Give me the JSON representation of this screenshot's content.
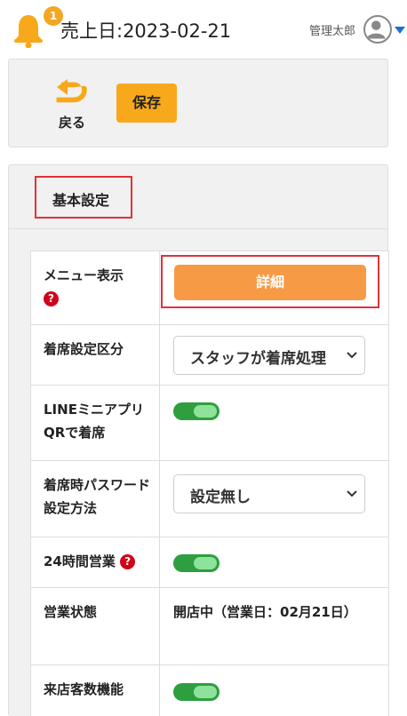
{
  "header": {
    "notification_count": "1",
    "title": "売上日:2023-02-21",
    "user_name": "管理太郎"
  },
  "toolbar": {
    "back_label": "戻る",
    "save_label": "保存"
  },
  "section": {
    "title": "基本設定"
  },
  "rows": [
    {
      "label": "メニュー表示",
      "help": true,
      "type": "button",
      "value": "詳細"
    },
    {
      "label": "着席設定区分",
      "help": false,
      "type": "select",
      "value": "スタッフが着席処理"
    },
    {
      "label": "LINEミニアプリQRで着席",
      "help": false,
      "type": "toggle",
      "on": true
    },
    {
      "label": "着席時パスワード設定方法",
      "help": false,
      "type": "select",
      "value": "設定無し"
    },
    {
      "label": "24時間営業",
      "help": true,
      "type": "toggle",
      "on": true
    },
    {
      "label": "営業状態",
      "help": false,
      "type": "text",
      "value": "開店中（営業日：02月21日）"
    },
    {
      "label": "来店客数機能",
      "help": false,
      "type": "toggle",
      "on": true
    }
  ],
  "colors": {
    "accent_orange": "#f7a81b",
    "detail_button": "#f79a45",
    "toggle_on": "#2e9e3e",
    "highlight_outline": "#e0323c",
    "help_icon": "#d0021b",
    "caret_blue": "#1f6fd1"
  },
  "icons": {
    "bell": "bell-icon",
    "avatar": "user-avatar-icon",
    "caret": "caret-down-icon",
    "back": "return-arrow-icon",
    "help": "question-mark-icon",
    "chevron": "chevron-down-icon"
  }
}
